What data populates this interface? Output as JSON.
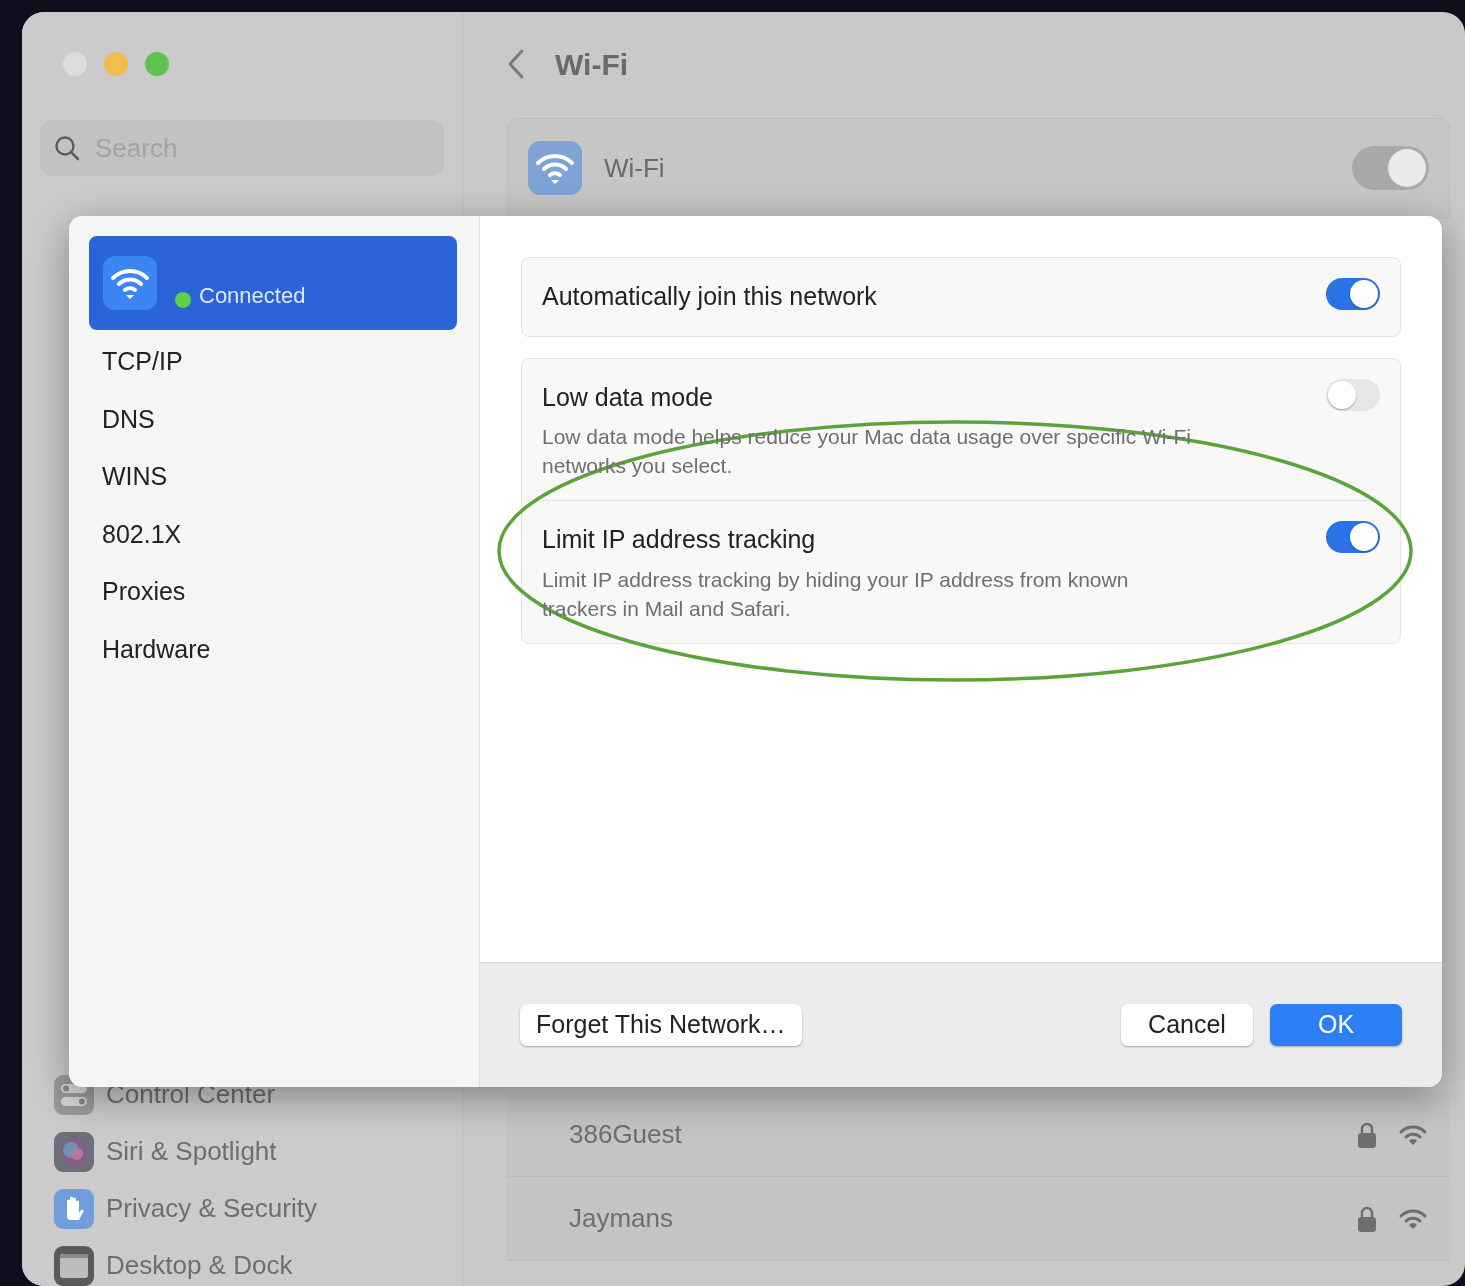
{
  "sidebar": {
    "search": {
      "placeholder": "Search"
    },
    "items": [
      {
        "label": "Control Center",
        "kind": "switches"
      },
      {
        "label": "Siri & Spotlight",
        "kind": "siri"
      },
      {
        "label": "Privacy & Security",
        "kind": "hand"
      },
      {
        "label": "Desktop & Dock",
        "kind": "dock"
      }
    ]
  },
  "main": {
    "title": "Wi-Fi",
    "wifi": {
      "label": "Wi-Fi",
      "on": true
    },
    "networks": [
      {
        "name": "386Guest",
        "locked": true
      },
      {
        "name": "Jaymans",
        "locked": true
      }
    ]
  },
  "sheet": {
    "network": {
      "status": "Connected",
      "selected": true
    },
    "nav": [
      {
        "label": "TCP/IP",
        "selected": false
      },
      {
        "label": "DNS",
        "selected": false
      },
      {
        "label": "WINS",
        "selected": false
      },
      {
        "label": "802.1X",
        "selected": false
      },
      {
        "label": "Proxies",
        "selected": false
      },
      {
        "label": "Hardware",
        "selected": false
      }
    ],
    "groups": [
      [
        {
          "title": "Automatically join this network",
          "on": true
        }
      ],
      [
        {
          "title": "Low data mode",
          "description": "Low data mode helps reduce your Mac data usage over specific Wi-Fi networks you select.",
          "on": false
        },
        {
          "title": "Limit IP address tracking",
          "description": "Limit IP address tracking by hiding your IP address from known trackers in Mail and Safari.",
          "on": true
        }
      ]
    ],
    "buttons": {
      "forget": "Forget This Network…",
      "cancel": "Cancel",
      "ok": "OK"
    }
  }
}
